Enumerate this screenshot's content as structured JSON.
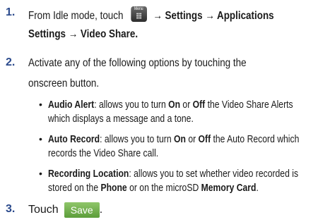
{
  "steps": [
    {
      "number": "1.",
      "line1_prefix": "From Idle mode, touch",
      "icon_label": "Menu",
      "line1_suffix": "→ Settings → Applications",
      "line2": "Settings → Video Share."
    },
    {
      "number": "2.",
      "line1": "Activate any of the following options by touching the",
      "line2": "onscreen button."
    },
    {
      "number": "3.",
      "prefix": "Touch",
      "button_label": "Save",
      "suffix": "."
    }
  ],
  "options": [
    {
      "title": "Audio Alert",
      "l1_a": ": allows you to turn ",
      "on": "On",
      "l1_b": " or ",
      "off": "Off",
      "l1_c": " the Video Share Alerts",
      "l2": "which displays a message and a tone."
    },
    {
      "title": "Auto Record",
      "l1_a": ": allows you to turn ",
      "on": "On",
      "l1_b": " or ",
      "off": "Off",
      "l1_c": " the Auto Record which",
      "l2": "records the Video Share call."
    },
    {
      "title": "Recording Location",
      "l1_a": ": allows you to set whether video recorded is",
      "l2_a": "stored on the ",
      "phone": "Phone",
      "l2_b": " or on the microSD ",
      "card": "Memory Card",
      "l2_c": "."
    }
  ],
  "bullet_char": "•",
  "colors": {
    "number": "#2b4a8c",
    "save_button": "#6ba847"
  }
}
